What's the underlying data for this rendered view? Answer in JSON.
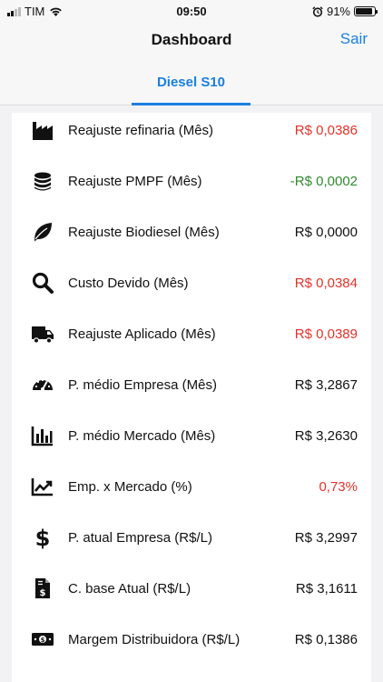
{
  "status_bar": {
    "carrier": "TIM",
    "time": "09:50",
    "battery": "91%",
    "battery_level": 0.91,
    "icons": [
      "signal-icon",
      "wifi-icon",
      "alarm-icon",
      "battery-icon"
    ]
  },
  "nav": {
    "title": "Dashboard",
    "right_button": "Sair"
  },
  "tabs": [
    {
      "label": "Diesel S10",
      "selected": true
    }
  ],
  "colors": {
    "accent": "#1a7fe0",
    "negative": "#e5312b",
    "positive": "#2e8b2e"
  },
  "rows": [
    {
      "icon": "factory-icon",
      "label": "Reajuste refinaria (Mês)",
      "value": "R$ 0,0386",
      "tone": "red"
    },
    {
      "icon": "coins-icon",
      "label": "Reajuste PMPF (Mês)",
      "value": "-R$ 0,0002",
      "tone": "green"
    },
    {
      "icon": "leaf-icon",
      "label": "Reajuste Biodiesel (Mês)",
      "value": "R$ 0,0000",
      "tone": "black"
    },
    {
      "icon": "search-icon",
      "label": "Custo Devido (Mês)",
      "value": "R$ 0,0384",
      "tone": "red"
    },
    {
      "icon": "truck-icon",
      "label": "Reajuste Aplicado (Mês)",
      "value": "R$ 0,0389",
      "tone": "red"
    },
    {
      "icon": "speedometer-icon",
      "label": "P. médio Empresa (Mês)",
      "value": "R$ 3,2867",
      "tone": "black"
    },
    {
      "icon": "bar-chart-icon",
      "label": "P. médio Mercado (Mês)",
      "value": "R$ 3,2630",
      "tone": "black"
    },
    {
      "icon": "trend-chart-icon",
      "label": "Emp. x Mercado (%)",
      "value": "0,73%",
      "tone": "red"
    },
    {
      "icon": "dollar-icon",
      "label": "P. atual Empresa (R$/L)",
      "value": "R$ 3,2997",
      "tone": "black"
    },
    {
      "icon": "invoice-icon",
      "label": "C. base Atual (R$/L)",
      "value": "R$ 3,1611",
      "tone": "black"
    },
    {
      "icon": "money-bill-icon",
      "label": "Margem Distribuidora (R$/L)",
      "value": "R$ 0,1386",
      "tone": "black"
    }
  ]
}
